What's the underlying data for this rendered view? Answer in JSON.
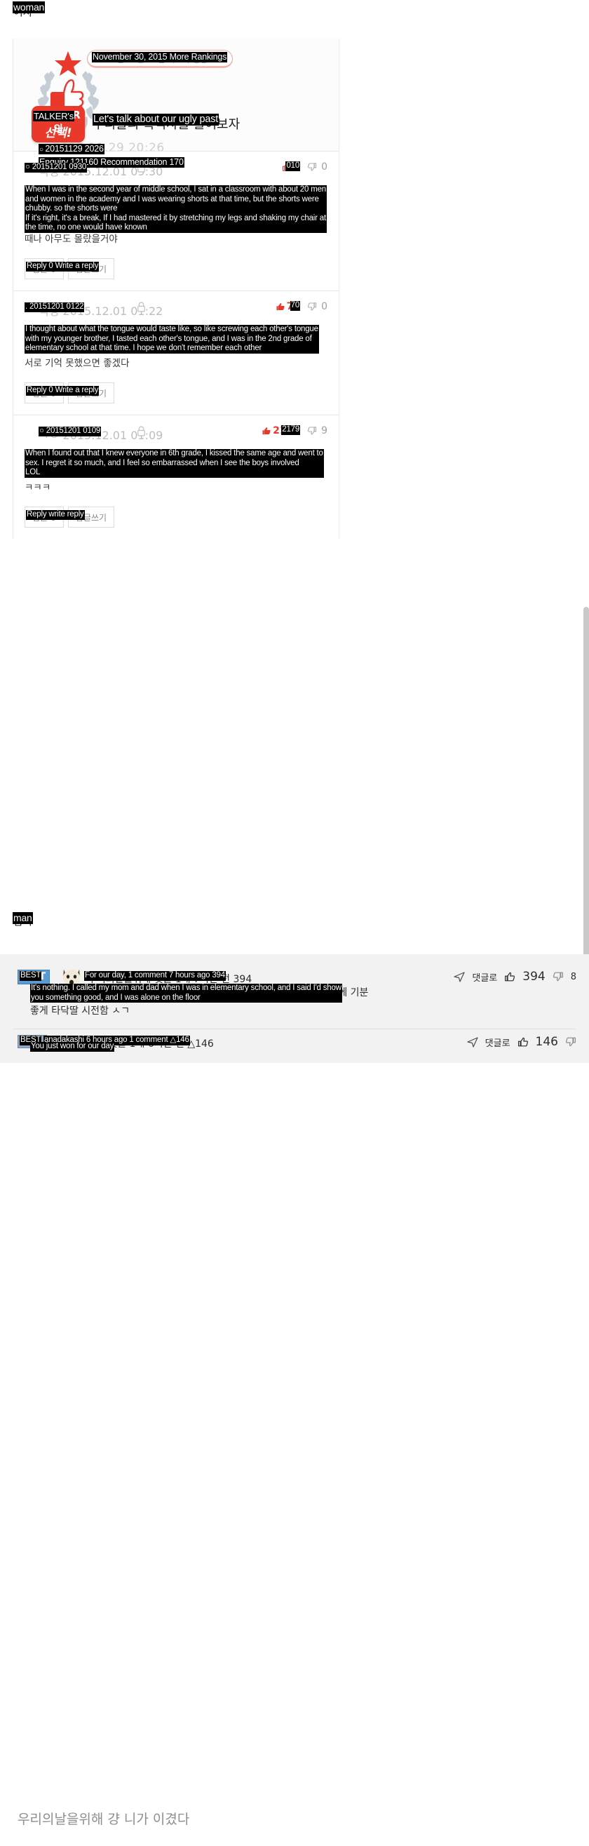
{
  "labels": {
    "top_section": "woman",
    "top_section_original": "여자",
    "bottom_section": "man",
    "bottom_section_original": "남자"
  },
  "post": {
    "emblem_badge_line1_original": "TALKER의",
    "emblem_badge_line2_original": "선택!",
    "emblem_badge_translation": "TALKER's",
    "ranking_pill_original": "2015년 11월 30일 더보기 랭킹",
    "ranking_pill_translation": "November 30, 2015 More Rankings",
    "title_original": "우리들의 흑역사를 풀어보자",
    "title_translation": "Let's talk about our ugly past",
    "meta_date_original": "2015.11.29 20:26",
    "meta_date_translation": "20151129 2026",
    "meta_stats_original": "조회 121160 추천 170",
    "meta_stats_translation": "Enquiry 121160 Recommendation 170"
  },
  "comments": [
    {
      "author_original": "익명 2015.12.01 09:30",
      "author_translation": "20151201 0930",
      "time_tail": "01 09:30",
      "upvotes": "0",
      "upvotes_translation": "010",
      "downvotes": "0",
      "body_original": "중학교 2학년때 학원에서 남자 20명쯤 있는데\n여자랑 같이 앉아있었는데 그때 반바지 입고 있었는데 통통해서 가따\n맞으면 쉬는시간에 다리 쭉 뻗고 의자 흔들면서 아무\n때나 아무도 몰랐을거야",
      "body_translation": "When I was in the second year of middle school, I sat in a classroom with about 20 men\nand women in the academy and I was wearing shorts at that time, but the shorts were\nchubby. so the shorts were\nIf it's right, it's a break, If I had mastered it by stretching my legs and shaking my chair at\nthe time, no one would have known",
      "action_reply_count_original": "답글 0",
      "action_write_original": "답글쓰기",
      "action_translation": "Reply 0 Write a reply"
    },
    {
      "author_original": "익명 2015.12.01 01:22",
      "author_translation": "20151201 0122",
      "time_tail": "01 01:22",
      "upvotes": "70",
      "upvotes_translation": "70",
      "downvotes": "0",
      "body_original": "혀가 무슨 맛일까 생각해서 서로 혀를 빠는 것처럼 동생이\n남동생이랑 서로 혀 맛보고 그때 초등학교 2학년이었음 동생임\n서로 기억 못했으면 좋겠다",
      "body_translation": "I thought about what the tongue would taste like, so like screwing each other's tongue\nwith my younger brother, I tasted each other's tongue, and I was in the 2nd grade of\nelementary school at that time. I hope we don't remember each other",
      "action_reply_count_original": "답글 0",
      "action_write_original": "답글쓰기",
      "action_translation": "Reply 0 Write a reply"
    },
    {
      "author_original": "ㅋㅇ 2015.12.01 01:09",
      "author_translation": "20151201 0109",
      "time_tail": "01 01:09",
      "upvotes": "2179",
      "upvotes_translation": "2179",
      "downvotes": "9",
      "body_original": "6학년때 다 아는 사이인걸 알고 동갑이랑 뽀뽀하고 ㄹㅇ\n섹스까지 함 너무 후회되고 그 남자애들 볼 때마다 쪽팔림.... ㅋ\nㅋㅋㅋ",
      "body_translation": "When I found out that I knew everyone in 6th grade, I kissed the same age and went to\nsex. I regret it so much, and I feel so embarrassed when I see the boys involved\nLOL",
      "action_reply_count_original": "답글 0",
      "action_write_original": "답글쓰기",
      "action_translation": "Reply write reply"
    }
  ],
  "bottom_comments": [
    {
      "badge": "BEST",
      "badge_translation": "BEST",
      "badge_letter": "T",
      "meta_original": "우리의날을위해 댓글 1개 7시간 전 394",
      "meta_translation": "For our day, 1 comment 7 hours ago 394",
      "reply_label_original": "댓글로",
      "like_count": "394",
      "dislike_count": "8",
      "body_original": "별거 아닌데 초등학생때 엄마아빠 불러서 좋은거 보여준다고 하고 혼자 바닥에 기분\n좋게 타닥딸 시전함 ㅅㄱ",
      "body_translation": "It's nothing. I called my mom and dad when I was in elementary school, and I said I'd show\nyou something good, and I was alone on the floor"
    },
    {
      "badge": "BEST",
      "badge_translation": "BEST",
      "badge_letter": "",
      "meta_original": "anadakashi 댓글 1개 6시간 전 △146",
      "meta_translation": "anadakashi 6 hours ago 1 comment △146",
      "reply_label_original": "댓글로",
      "like_count": "146",
      "dislike_count": "",
      "body_original": "우리의날을위해 걍 니가 이겼다",
      "body_translation": "You just won for our day"
    }
  ],
  "colors": {
    "accent_red": "#e8392a",
    "badge_blue": "#5b9bd5",
    "translation_bg": "#000000",
    "translation_fg": "#ffffff"
  }
}
